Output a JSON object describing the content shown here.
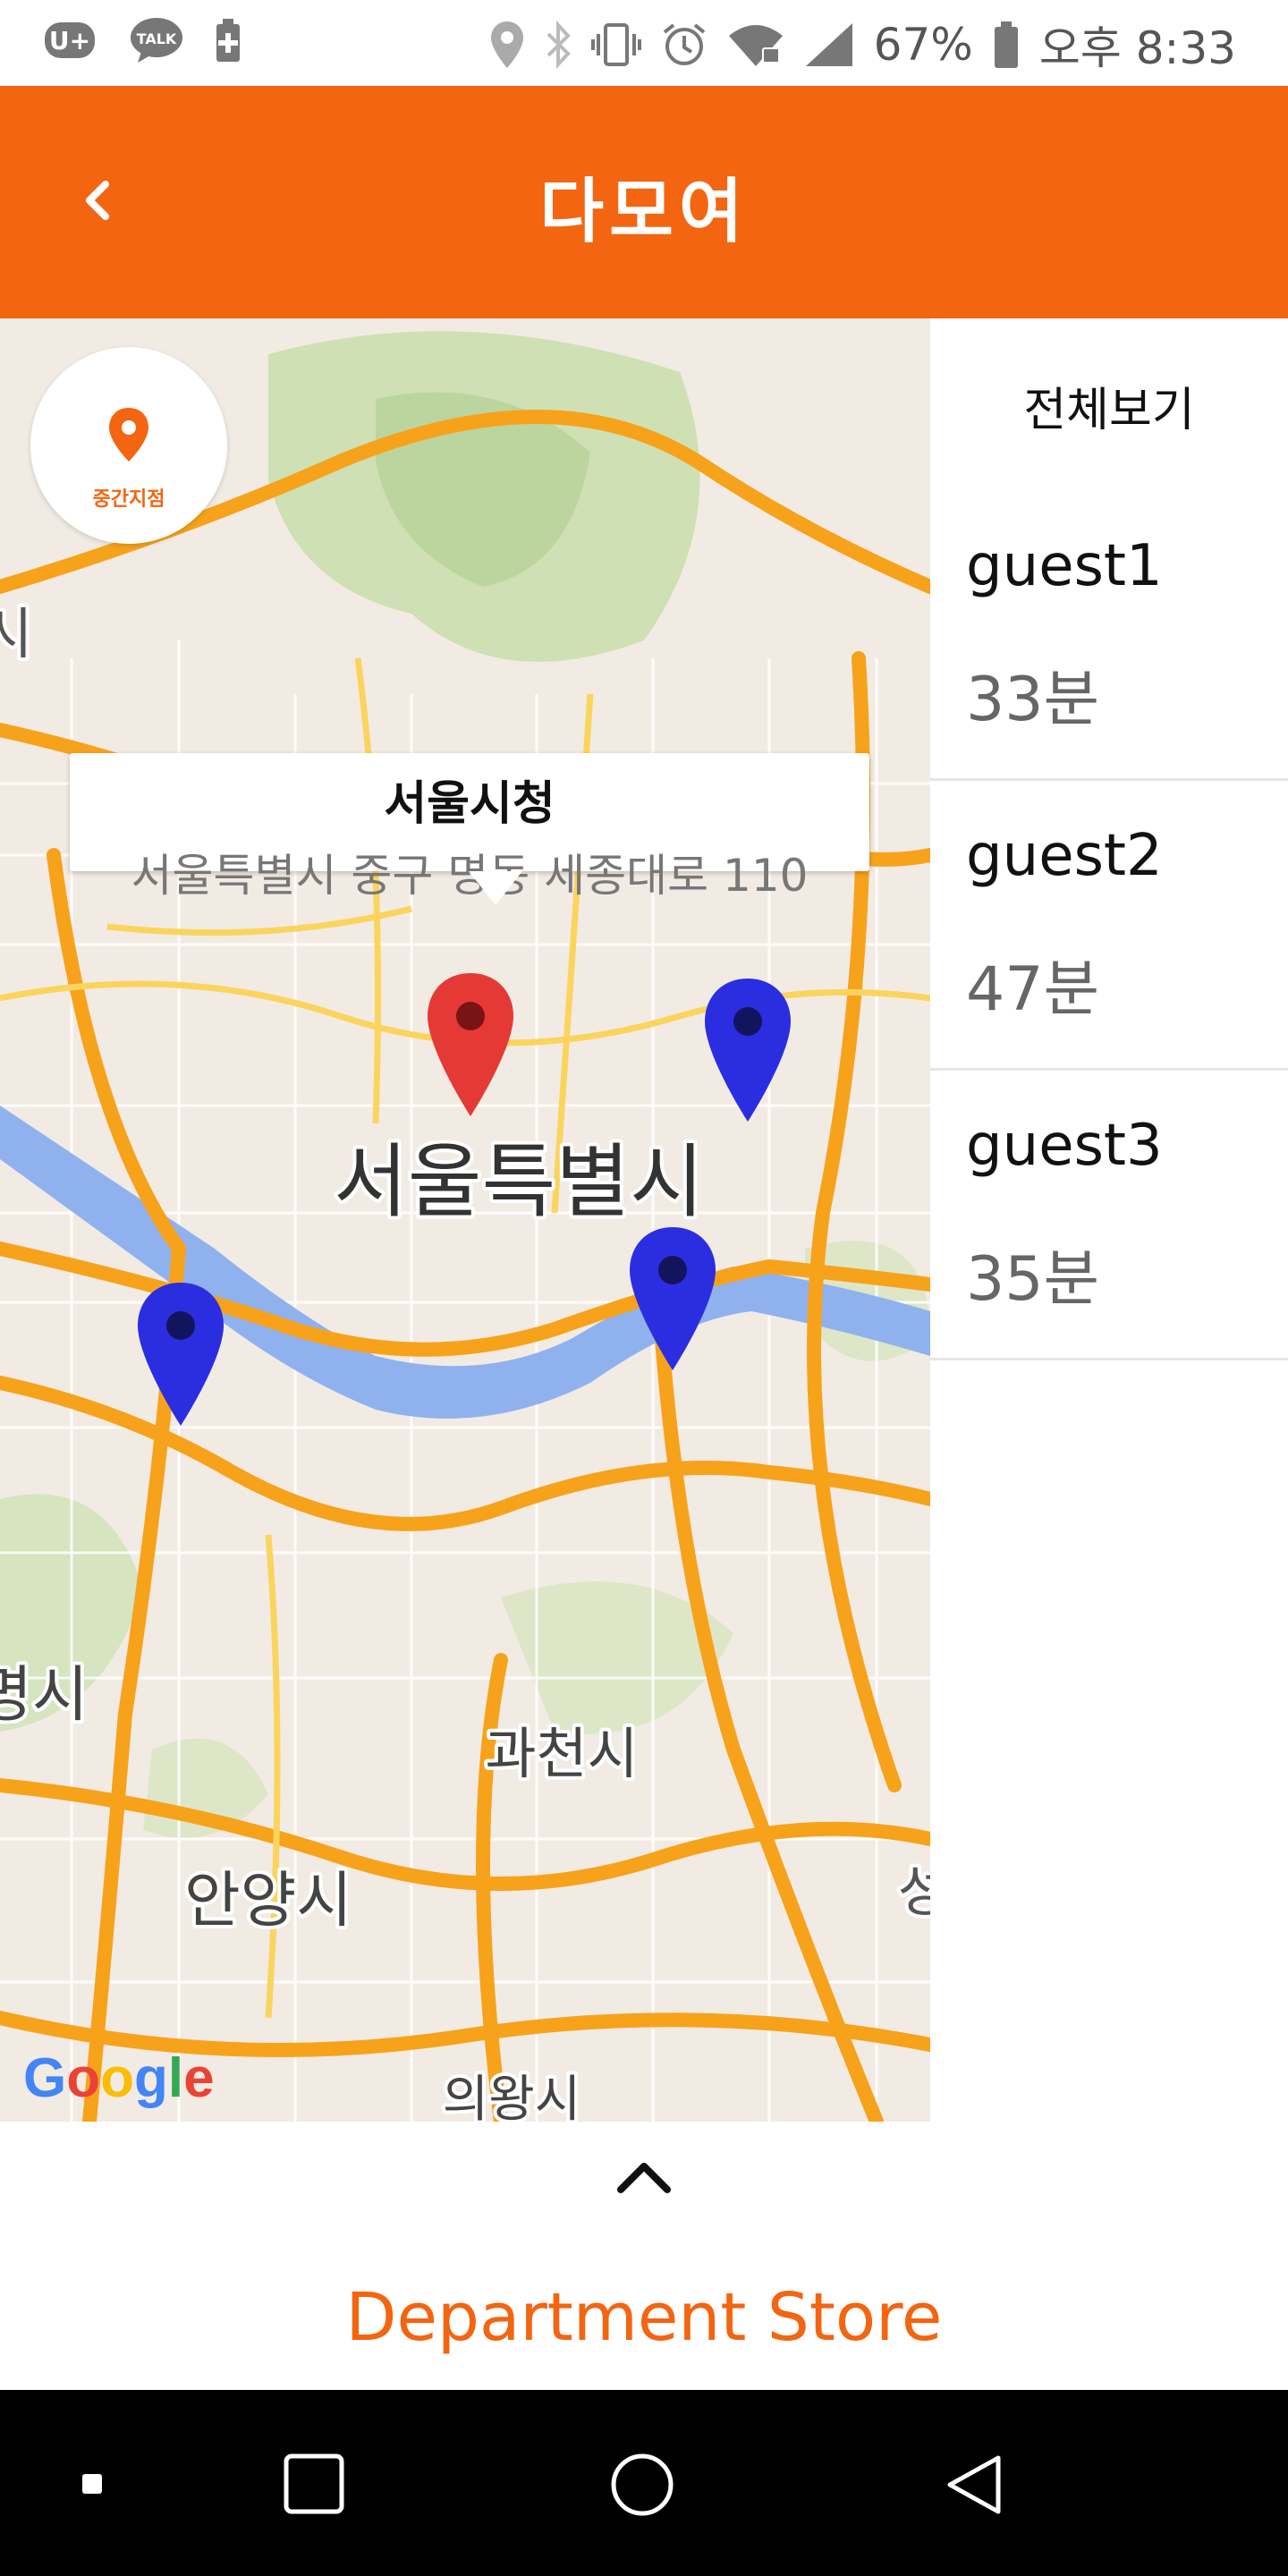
{
  "status_bar": {
    "battery": "67%",
    "time": "오후 8:33",
    "left_icons": [
      "u-plus-icon",
      "talk-icon",
      "battery-saver-icon"
    ],
    "right_icons": [
      "location-icon",
      "bluetooth-icon",
      "vibrate-icon",
      "alarm-icon",
      "wifi-icon",
      "signal-icon",
      "battery-icon"
    ]
  },
  "app_bar": {
    "title": "다모여",
    "back_icon": "chevron-left-icon"
  },
  "map": {
    "midpoint_button_label": "중간지점",
    "callout": {
      "title": "서울시청",
      "address": "서울특별시 중구 명동 세종대로 110"
    },
    "labels": {
      "city": "서울특별시",
      "gwacheon": "과천시",
      "anyang": "안양시",
      "gwangmyeong": "명시",
      "uiwang": "의왕시",
      "left_edge": "시",
      "right_edge": "성"
    },
    "google_logo": "Google",
    "colors": {
      "midpoint_marker": "#e53935",
      "guest_marker": "#2b2ee0",
      "road": "#f7a21b",
      "river": "#8fb2ef"
    }
  },
  "panel": {
    "view_all": "전체보기",
    "guests": [
      {
        "name": "guest1",
        "time": "33분"
      },
      {
        "name": "guest2",
        "time": "47분"
      },
      {
        "name": "guest3",
        "time": "35분"
      }
    ]
  },
  "bottom_sheet": {
    "expand_icon": "chevron-up-icon",
    "place_type": "Department Store"
  },
  "nav_bar": {
    "buttons": [
      "dot-icon",
      "recent-apps-icon",
      "home-icon",
      "back-icon"
    ]
  },
  "theme": {
    "accent": "#f36511"
  }
}
